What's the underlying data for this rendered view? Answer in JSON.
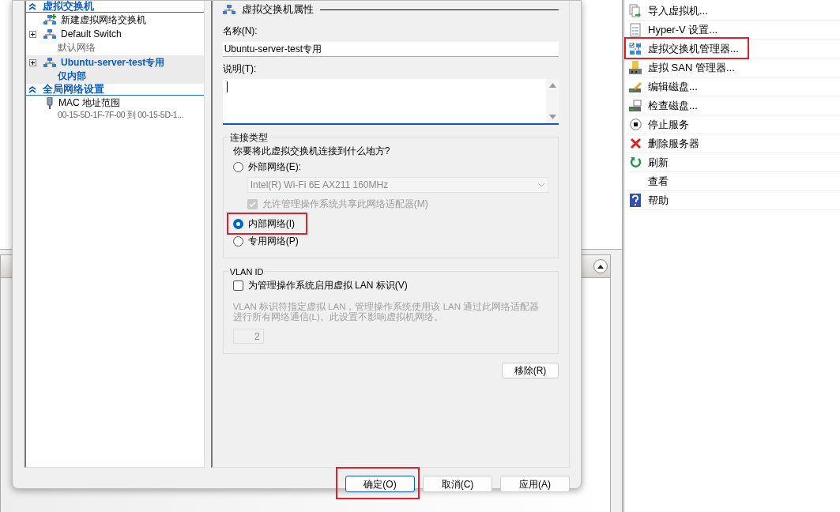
{
  "tree": {
    "sections": [
      {
        "title": "虚拟交换机",
        "items": [
          {
            "kind": "new",
            "label": "新建虚拟网络交换机",
            "selected": false
          },
          {
            "kind": "switch",
            "label": "Default Switch",
            "sublabel": "默认网络",
            "selected": false
          },
          {
            "kind": "switch",
            "label": "Ubuntu-server-test专用",
            "sublabel": "仅内部",
            "selected": true
          }
        ]
      },
      {
        "title": "全局网络设置",
        "items": [
          {
            "kind": "mac",
            "label": "MAC 地址范围",
            "sublabel": "00-15-5D-1F-7F-00 到 00-15-5D-1...",
            "selected": false
          }
        ]
      }
    ]
  },
  "properties": {
    "title": "虚拟交换机属性",
    "name_label": "名称(N):",
    "name_value": "Ubuntu-server-test专用",
    "notes_label": "说明(T):",
    "connection": {
      "title": "连接类型",
      "question": "你要将此虚拟交换机连接到什么地方?",
      "options": [
        {
          "kind": "external",
          "label": "外部网络(E):",
          "selected": false,
          "highlighted": false
        },
        {
          "kind": "internal",
          "label": "内部网络(I)",
          "selected": true,
          "highlighted": true
        },
        {
          "kind": "private",
          "label": "专用网络(P)",
          "selected": false,
          "highlighted": false
        }
      ],
      "adapter": {
        "value": "Intel(R) Wi-Fi 6E AX211 160MHz",
        "disabled": true
      },
      "share": {
        "label": "允许管理操作系统共享此网络适配器(M)",
        "checked": true,
        "disabled": true
      }
    },
    "vlan": {
      "title": "VLAN ID",
      "checkbox": {
        "label": "为管理操作系统启用虚拟 LAN 标识(V)",
        "checked": false
      },
      "description": "VLAN 标识符指定虚拟 LAN，管理操作系统使用该 LAN 通过此网络适配器进行所有网络通信(L)。此设置不影响虚拟机网络。",
      "value": "2",
      "disabled": true
    },
    "remove_button": "移除(R)"
  },
  "buttons": [
    {
      "label": "确定(O)",
      "default": true,
      "highlighted": true
    },
    {
      "label": "取消(C)",
      "default": false,
      "highlighted": false
    },
    {
      "label": "应用(A)",
      "default": false,
      "highlighted": false
    }
  ],
  "actions": [
    {
      "kind": "import",
      "label": "导入虚拟机...",
      "highlighted": false
    },
    {
      "kind": "settings",
      "label": "Hyper-V 设置...",
      "highlighted": false
    },
    {
      "kind": "switch-manager",
      "label": "虚拟交换机管理器...",
      "highlighted": true
    },
    {
      "kind": "san",
      "label": "虚拟 SAN 管理器...",
      "highlighted": false
    },
    {
      "kind": "edit-disk",
      "label": "编辑磁盘...",
      "highlighted": false
    },
    {
      "kind": "inspect-disk",
      "label": "检查磁盘...",
      "highlighted": false
    },
    {
      "kind": "stop",
      "label": "停止服务",
      "highlighted": false
    },
    {
      "kind": "delete",
      "label": "删除服务器",
      "highlighted": false
    },
    {
      "kind": "refresh",
      "label": "刷新",
      "highlighted": false
    },
    {
      "kind": "view",
      "label": "查看",
      "highlighted": false
    },
    {
      "kind": "help",
      "label": "帮助",
      "highlighted": false
    }
  ]
}
